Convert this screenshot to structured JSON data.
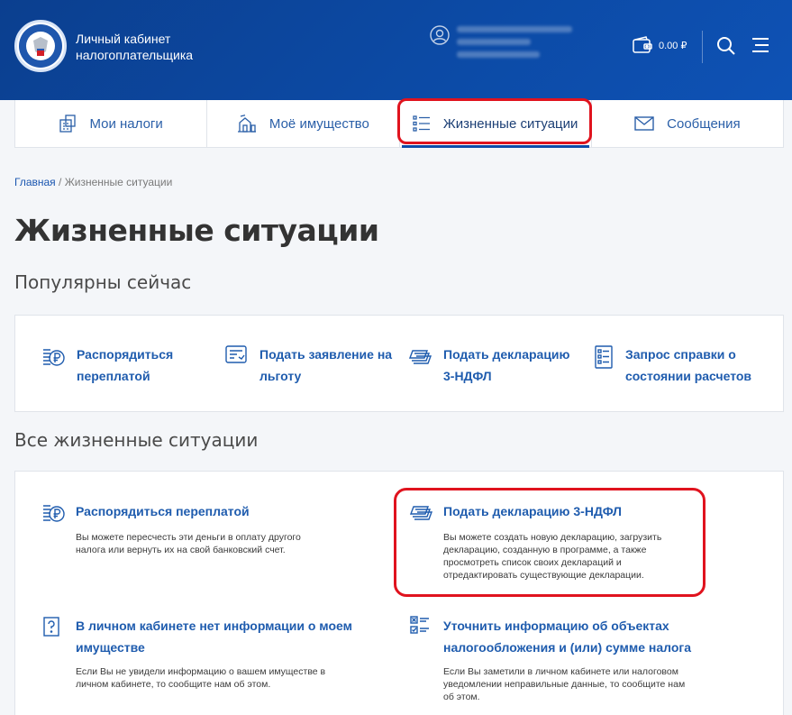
{
  "header": {
    "brand_line1": "Личный кабинет",
    "brand_line2": "налогоплательщика",
    "balance": "0.00 ₽"
  },
  "tabs": [
    {
      "label": "Мои налоги",
      "icon": "calculator-icon"
    },
    {
      "label": "Моё имущество",
      "icon": "property-icon"
    },
    {
      "label": "Жизненные ситуации",
      "icon": "list-icon",
      "active": true
    },
    {
      "label": "Сообщения",
      "icon": "envelope-icon"
    }
  ],
  "breadcrumb": {
    "home": "Главная",
    "separator": " / ",
    "current": "Жизненные ситуации"
  },
  "page_title": "Жизненные ситуации",
  "popular": {
    "title": "Популярны сейчас",
    "items": [
      {
        "line1": "Распорядиться",
        "line2": "переплатой",
        "icon": "ruble-coins-icon"
      },
      {
        "line1": "Подать заявление на",
        "line2": "льготу",
        "icon": "form-icon"
      },
      {
        "line1": "Подать декларацию",
        "line2": "3-НДФЛ",
        "icon": "documents-stack-icon"
      },
      {
        "line1": "Запрос справки о",
        "line2": "состоянии расчетов",
        "icon": "document-list-icon"
      }
    ]
  },
  "all": {
    "title": "Все жизненные ситуации",
    "items": [
      {
        "title": "Распорядиться переплатой",
        "title2": "",
        "icon": "ruble-coins-icon",
        "desc1": "Вы можете пересчесть эти деньги в оплату другого",
        "desc2": "налога или вернуть их на свой банковский счет.",
        "desc3": "",
        "desc4": ""
      },
      {
        "title": "Подать декларацию 3-НДФЛ",
        "title2": "",
        "icon": "documents-stack-icon",
        "desc1": "Вы можете создать новую декларацию, загрузить",
        "desc2": "декларацию, созданную в программе, а также",
        "desc3": "просмотреть список своих деклараций и",
        "desc4": "отредактировать существующие декларации."
      },
      {
        "title": "В личном кабинете нет информации о моем",
        "title2": "имуществе",
        "icon": "question-icon",
        "desc1": "Если Вы не увидели информацию о вашем имуществе в",
        "desc2": "личном кабинете, то сообщите нам об этом.",
        "desc3": "",
        "desc4": ""
      },
      {
        "title": "Уточнить информацию об объектах",
        "title2": "налогообложения и (или) сумме налога",
        "icon": "checklist-icon",
        "desc1": "Если Вы заметили в личном кабинете или налоговом",
        "desc2": "уведомлении неправильные данные, то сообщите нам",
        "desc3": "об этом.",
        "desc4": ""
      }
    ]
  },
  "colors": {
    "header_blue": "#0c4aa5",
    "link_blue": "#1f5cae",
    "highlight_red": "#e0131e"
  }
}
